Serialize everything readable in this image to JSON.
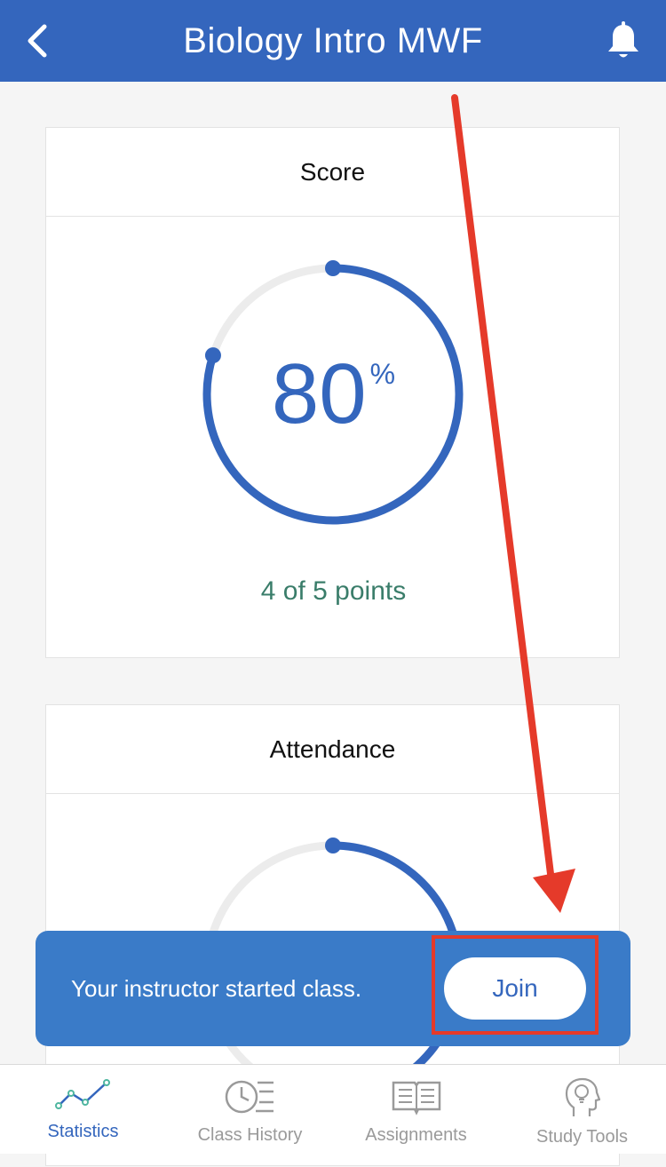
{
  "header": {
    "title": "Biology Intro MWF",
    "back_icon": "chevron-left-icon",
    "bell_icon": "bell-icon"
  },
  "score": {
    "title": "Score",
    "percent": "80",
    "percent_sign": "%",
    "points_text": "4 of 5 points",
    "fraction": 0.8
  },
  "attendance": {
    "title": "Attendance"
  },
  "toast": {
    "message": "Your instructor started class.",
    "join_label": "Join"
  },
  "tabs": [
    {
      "label": "Statistics",
      "icon": "line-chart-icon",
      "active": true
    },
    {
      "label": "Class History",
      "icon": "clock-list-icon",
      "active": false
    },
    {
      "label": "Assignments",
      "icon": "open-book-icon",
      "active": false
    },
    {
      "label": "Study Tools",
      "icon": "head-lightbulb-icon",
      "active": false
    }
  ],
  "colors": {
    "primary": "#3466bd",
    "toast": "#3a7bc8",
    "points_green": "#3a7d6a",
    "annotation_red": "#e53a2a"
  }
}
